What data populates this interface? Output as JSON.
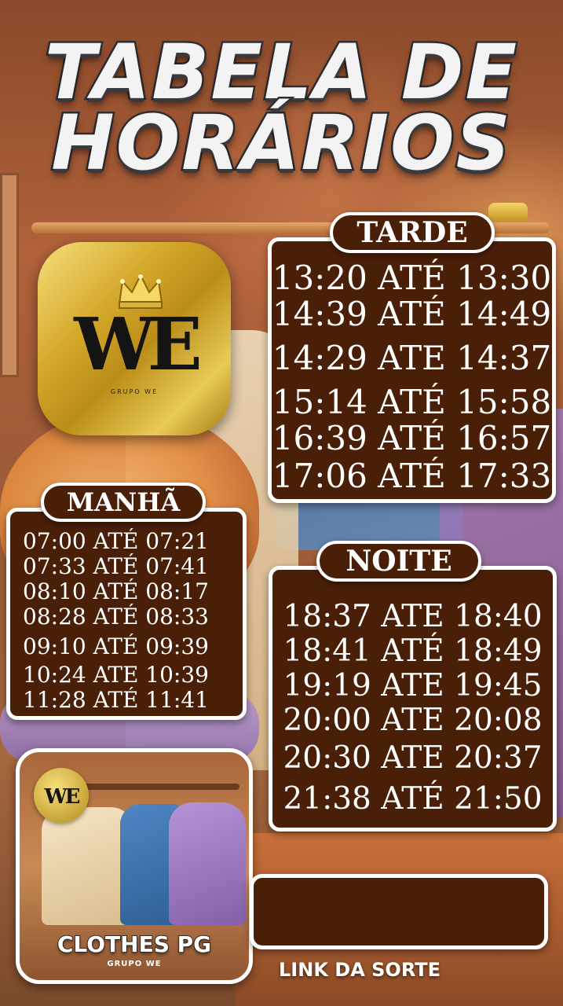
{
  "title": {
    "line1": "TABELA DE",
    "line2": "HORÁRIOS"
  },
  "logo": {
    "monogram": "WE",
    "subtitle": "GRUPO WE"
  },
  "tarde": {
    "label": "TARDE",
    "rows": [
      "13:20 ATÉ 13:30",
      "14:39 ATÉ 14:49",
      "14:29 ATE 14:37",
      "15:14 ATÉ 15:58",
      "16:39 ATÉ 16:57",
      "17:06 ATÉ 17:33"
    ]
  },
  "manha": {
    "label": "MANHÃ",
    "rows": [
      "07:00 ATÉ 07:21",
      "07:33 ATÉ 07:41",
      "08:10 ATÉ 08:17",
      "08:28 ATÉ 08:33",
      "09:10 ATÉ 09:39",
      "10:24 ATE 10:39",
      "11:28 ATÉ 11:41"
    ]
  },
  "noite": {
    "label": "NOITE",
    "rows": [
      "18:37 ATE 18:40",
      "18:41 ATÉ 18:49",
      "19:19 ATE 19:45",
      "20:00 ATE 20:08",
      "20:30 ATE 20:37",
      "21:38 ATÉ 21:50"
    ]
  },
  "card": {
    "mini_logo": "WE",
    "brand": "CLOTHES PG",
    "brand_sub": "GRUPO WE"
  },
  "link": {
    "label": "LINK DA SORTE"
  },
  "colors": {
    "panel": "#4a1f08",
    "border": "#ffffff",
    "gold": "#d4a72a"
  }
}
